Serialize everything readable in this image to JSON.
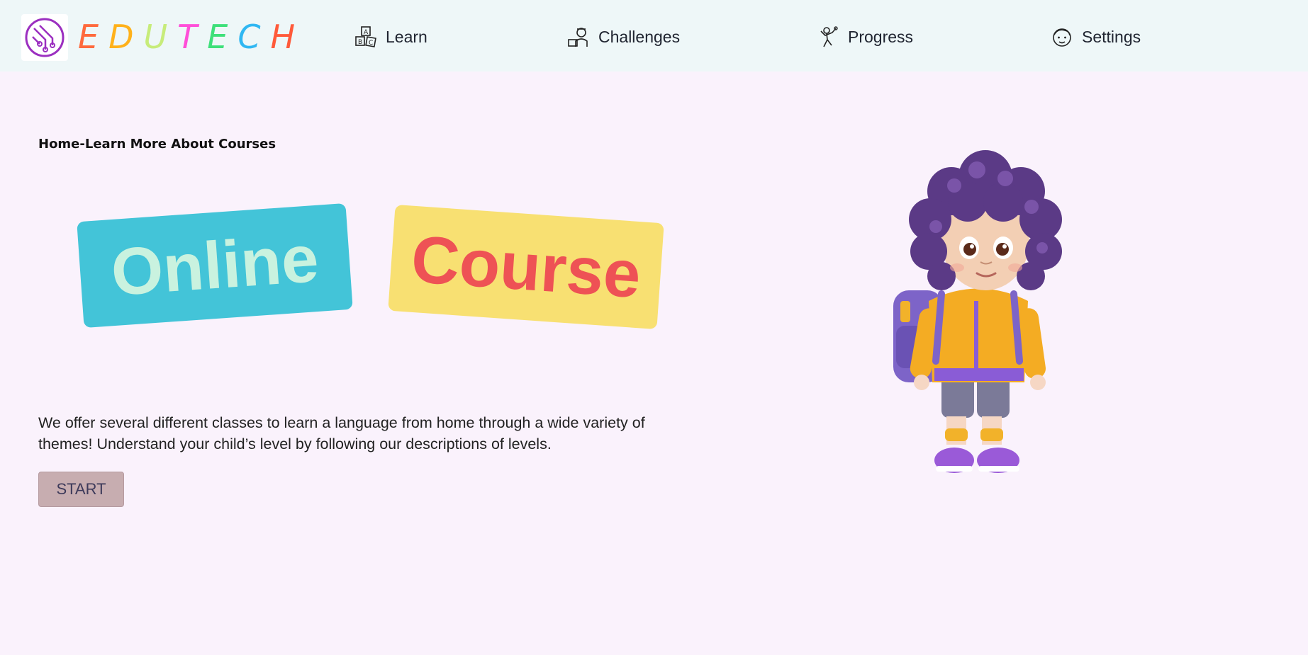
{
  "brand": {
    "letters": [
      "E",
      "D",
      "U",
      "T",
      "E",
      "C",
      "H"
    ],
    "letter_colors": [
      "#ff6a3d",
      "#ffb11a",
      "#c7ec7a",
      "#ff4fd8",
      "#3ee07a",
      "#2fb7f2",
      "#ff5a3a"
    ],
    "logo_icon": "circuit-logo-icon",
    "logo_color": "#9b2fc0"
  },
  "nav": {
    "items": [
      {
        "label": "Learn",
        "icon": "abc-blocks-icon"
      },
      {
        "label": "Challenges",
        "icon": "student-computer-icon"
      },
      {
        "label": "Progress",
        "icon": "climber-icon"
      },
      {
        "label": "Settings",
        "icon": "face-icon"
      }
    ]
  },
  "main": {
    "breadcrumb": "Home-Learn More About Courses",
    "tiles": {
      "left_word": "Online",
      "right_word": "Course"
    },
    "description": "We offer several different classes to learn a language from home through a wide variety of themes! Understand your child’s level by following our descriptions of levels.",
    "start_label": "START",
    "illustration": "child-with-backpack-illustration"
  },
  "colors": {
    "page_bg": "#faf2fc",
    "header_bg": "#eef7f8",
    "online_tile": "#43c4d8",
    "course_tile": "#f8e072",
    "start_button": "#c7adb0"
  }
}
